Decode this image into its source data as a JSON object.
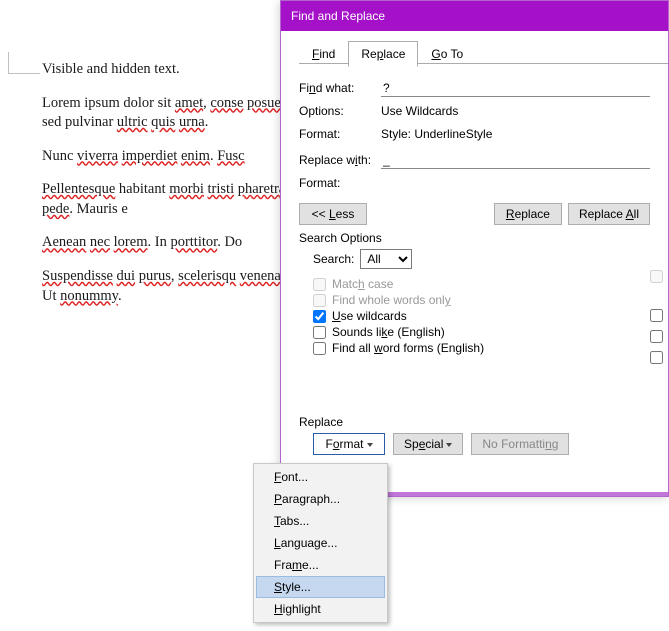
{
  "dialog": {
    "title": "Find and Replace",
    "tabs": {
      "find": "Find",
      "replace": "Replace",
      "goto": "Go To"
    },
    "find_what_label": "Find what:",
    "find_what_value": "?",
    "options_label": "Options:",
    "options_value": "Use Wildcards",
    "format_label": "Format:",
    "format_value": "Style: UnderlineStyle",
    "replace_with_label": "Replace with:",
    "replace_with_value": "_",
    "format2_label": "Format:",
    "less_btn": "<< Less",
    "replace_btn": "Replace",
    "replace_all_btn": "Replace All",
    "search_options_label": "Search Options",
    "search_label": "Search:",
    "search_value": "All",
    "opt_match_case": "Match case",
    "opt_whole_words": "Find whole words only",
    "opt_wildcards": "Use wildcards",
    "opt_sounds_like": "Sounds like (English)",
    "opt_word_forms": "Find all word forms (English)",
    "replace_section_label": "Replace",
    "format_btn": "Format",
    "special_btn": "Special",
    "no_formatting_btn": "No Formatting"
  },
  "menu": {
    "font": "Font...",
    "paragraph": "Paragraph...",
    "tabs": "Tabs...",
    "language": "Language...",
    "frame": "Frame...",
    "style": "Style...",
    "highlight": "Highlight"
  },
  "doc": {
    "p1": "Visible and hidden text.",
    "p2": "Lorem ipsum dolor sit amet, consectetuer posuere, magna sed pulvinar ultricies quis urna.",
    "p3": "Nunc viverra imperdiet enim. Fusce",
    "p4": "Pellentesque habitant morbi tristique pharetra nonummy pede. Mauris e",
    "p5": "Aenean nec lorem. In porttitor. Do",
    "p6": "Suspendisse dui purus, scelerisque venenatis eleifend. Ut nonummy."
  }
}
